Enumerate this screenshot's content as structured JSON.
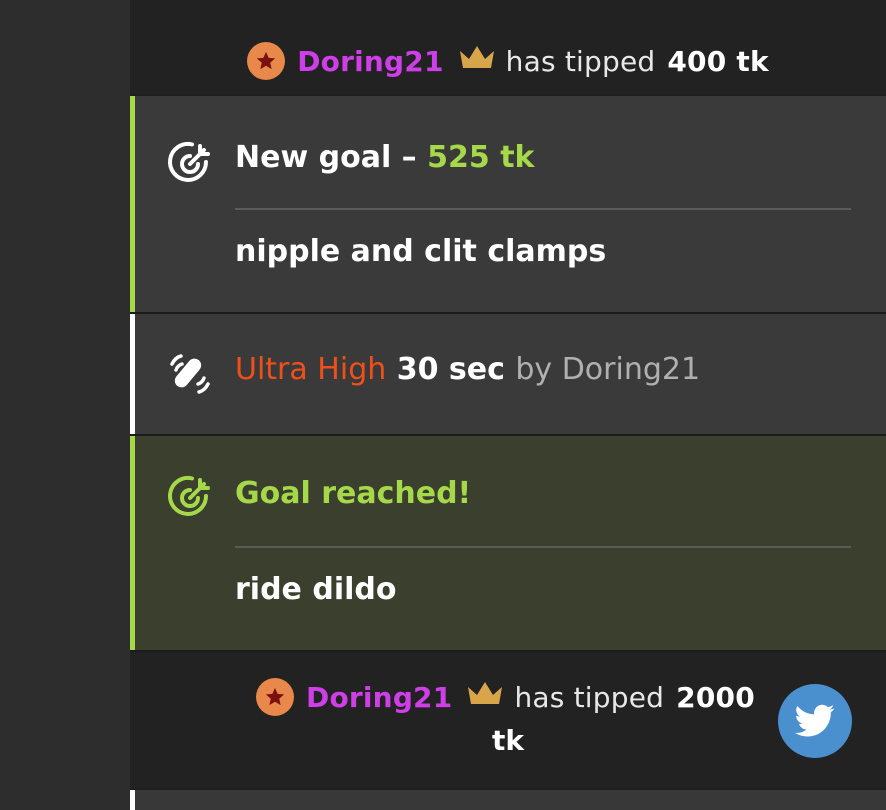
{
  "tip1": {
    "username": "Doring21",
    "text": "has tipped",
    "amount": "400 tk"
  },
  "goal_new": {
    "title_prefix": "New goal –",
    "title_amount": "525 tk",
    "description": "nipple and clit clamps"
  },
  "vibe": {
    "level": "Ultra High",
    "duration": "30 sec",
    "by": "by Doring21"
  },
  "goal_reached": {
    "title": "Goal reached!",
    "description": "ride dildo"
  },
  "tip2": {
    "username": "Doring21",
    "text": "has tipped",
    "amount_line1": "2000",
    "amount_line2": "tk"
  },
  "colors": {
    "username": "#cf3fe8",
    "accent_green": "#a6d94a",
    "accent_orange": "#ef4f1a",
    "twitter_blue": "#4a90cf",
    "badge_orange": "#e8884a",
    "crown_gold": "#d9a54a"
  },
  "icons": {
    "badge": "star-icon",
    "crown": "crown-icon",
    "goal": "target-icon",
    "vibe": "vibration-icon",
    "share": "twitter-icon"
  }
}
